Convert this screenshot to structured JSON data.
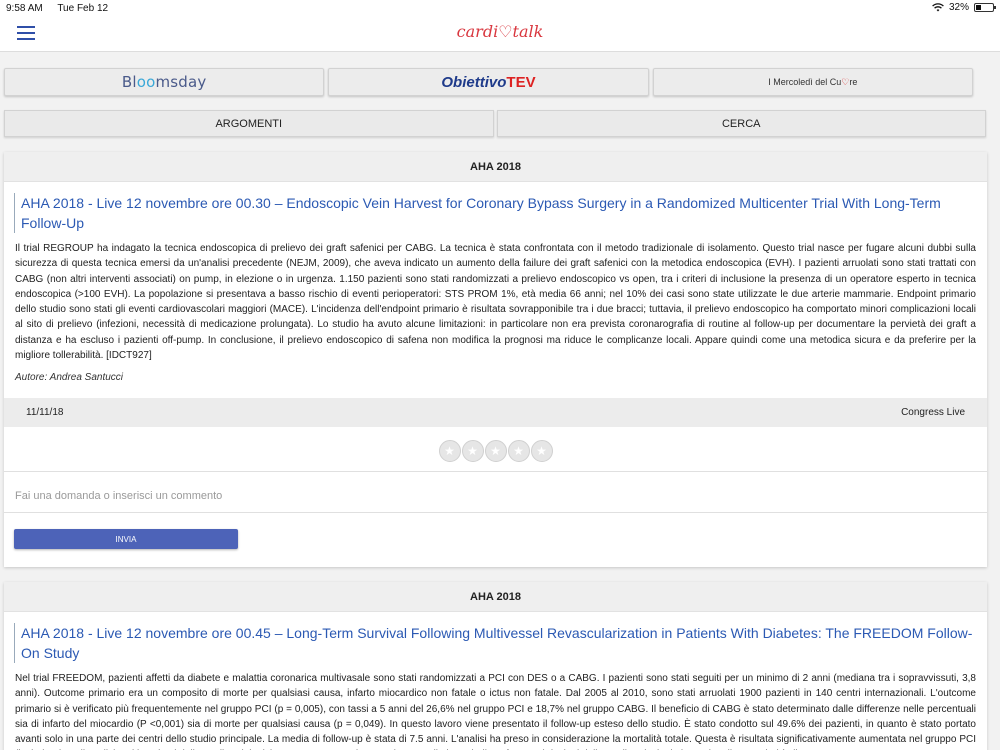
{
  "status": {
    "time": "9:58 AM",
    "date": "Tue Feb 12",
    "battery": "32%",
    "battery_level": 0.32
  },
  "app": {
    "logo_left": "cardi",
    "logo_right": "talk"
  },
  "nav": {
    "blooms_pre": "Bl",
    "blooms_oo": "oo",
    "blooms_post": "msday",
    "obiettivo_pre": "Obiettivo",
    "obiettivo_tev": "TEV",
    "merc_pre": "I Mercoledì del Cu",
    "merc_heart": "♡",
    "merc_post": "re"
  },
  "tabs": {
    "argomenti": "ARGOMENTI",
    "cerca": "CERCA"
  },
  "articles": [
    {
      "section": "AHA 2018",
      "title": "AHA 2018 - Live 12 novembre ore 00.30 – Endoscopic Vein Harvest for Coronary Bypass Surgery in a Randomized Multicenter Trial With Long-Term Follow-Up",
      "body": "Il trial REGROUP ha indagato la tecnica endoscopica di prelievo dei graft safenici per CABG.  La tecnica è stata confrontata con il metodo tradizionale di isolamento. Questo trial nasce per fugare alcuni dubbi sulla sicurezza di questa tecnica emersi da un'analisi precedente (NEJM, 2009), che aveva indicato un aumento della failure dei graft safenici con la metodica endoscopica (EVH).  I pazienti arruolati sono stati trattati con CABG (non altri interventi associati) on pump, in elezione o in urgenza. 1.150 pazienti sono stati randomizzati a prelievo endoscopico vs open, tra i criteri di inclusione la presenza di un operatore esperto in tecnica endoscopica (>100 EVH).  La popolazione si presentava a basso rischio di eventi perioperatori: STS PROM 1%, età media 66 anni; nel 10% dei casi sono state utilizzate le due arterie mammarie.  Endpoint primario dello studio sono stati gli eventi cardiovascolari maggiori (MACE).  L'incidenza dell'endpoint primario è risultata sovrapponibile tra i due bracci; tuttavia, il prelievo endoscopico ha comportato minori complicazioni locali al sito di prelievo (infezioni, necessità di medicazione prolungata).  Lo studio ha avuto alcune limitazioni: in particolare non era prevista coronarografia di routine al follow-up per documentare la pervietà dei graft a distanza e ha escluso i pazienti off-pump.  In conclusione, il prelievo endoscopico di safena non modifica la prognosi ma riduce le complicanze locali. Appare quindi come una metodica sicura e da preferire per la migliore tollerabilità.  [IDCT927]",
      "author": "Autore: Andrea Santucci",
      "date": "11/11/18",
      "tag": "Congress Live",
      "comment_placeholder": "Fai una domanda o inserisci un commento",
      "submit": "INVIA"
    },
    {
      "section": "AHA 2018",
      "title": "AHA 2018 - Live 12 novembre ore 00.45 – Long-Term Survival Following Multivessel Revascularization in Patients With Diabetes: The FREEDOM Follow-On Study",
      "body": "Nel trial FREEDOM, pazienti affetti da diabete e malattia coronarica multivasale sono stati randomizzati a PCI con DES o a CABG. I pazienti sono stati seguiti per un minimo di 2 anni (mediana tra i sopravvissuti, 3,8 anni). Outcome primario era un composito di morte per qualsiasi causa, infarto miocardico non fatale o ictus non fatale. Dal 2005 al 2010, sono stati arruolati 1900 pazienti in 140 centri internazionali. L'outcome primario si è verificato più frequentemente nel gruppo PCI (p = 0,005), con tassi a 5 anni del 26,6% nel gruppo PCI e 18,7% nel gruppo CABG. Il beneficio di CABG è stato determinato dalle differenze nelle percentuali sia di infarto del miocardio (P <0,001) sia di morte per qualsiasi causa (p = 0,049).  In questo lavoro viene presentato il follow-up esteso dello studio. È stato condotto sul 49.6% dei pazienti, in quanto è stato portato avanti solo in una parte dei centri dello studio principale. La media di follow-up è stata di 7.5 anni. L'analisi ha preso in considerazione la mortalità totale.  Questa è risultata significativamente aumentata nel gruppo PCI (includendo nell'analisi tutti i pazienti dello studio originale): 24,3% vs 18,3% (p = 0,01). Lo studio ha quindi confermato i risultati dello studio principale in merito alla superiorità di CABG"
    }
  ]
}
